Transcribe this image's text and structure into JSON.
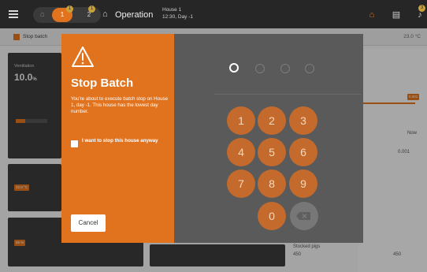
{
  "topbar": {
    "house_tabs": [
      {
        "label": "1",
        "badge": "1",
        "active": true
      },
      {
        "label": "2",
        "badge": "1",
        "active": false
      }
    ],
    "mode": "Operation",
    "house_name": "House 1",
    "house_time": "12:30, Day -1",
    "notification_badge": "3"
  },
  "subbar": {
    "status": "Stop batch",
    "temperature": "23.0 °C"
  },
  "background": {
    "ventilation_label": "Ventilation",
    "ventilation_value": "10.0",
    "ventilation_unit": "%",
    "temp_tag": "22.0 °C",
    "humidity_tag": "65 %",
    "right_now": "Now",
    "right_value": "0.001",
    "right_tag": "0.001",
    "stocked_label": "Stocked pigs",
    "stocked_value": "450",
    "stocked_right": "450"
  },
  "modal": {
    "title": "Stop Batch",
    "description": "You're about to execute batch stop on House 1, day -1. This house has the lowest day number.",
    "checkbox_label": "I want to stop this house anyway",
    "cancel_label": "Cancel",
    "pin_length": 4,
    "pin_filled": 1,
    "keys": [
      "1",
      "2",
      "3",
      "4",
      "5",
      "6",
      "7",
      "8",
      "9",
      "0"
    ]
  },
  "colors": {
    "accent": "#e2731e",
    "topbar": "#262626",
    "keypad_bg": "#5a5a5a",
    "key": "#c46a2c"
  }
}
